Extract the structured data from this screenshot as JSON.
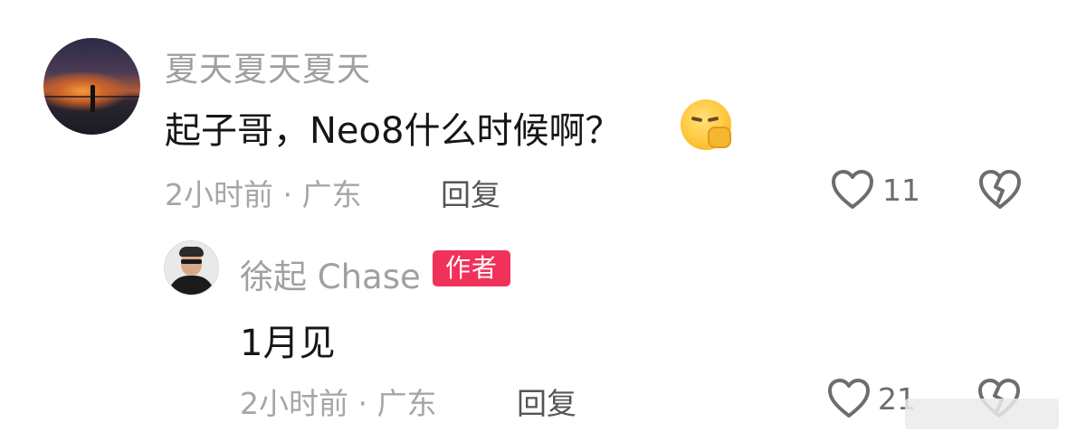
{
  "comments": [
    {
      "username": "夏天夏天夏天",
      "text": "起子哥，Neo8什么时候啊？",
      "emoji_icon": "shushing-face-emoji",
      "meta": "2小时前 · 广东",
      "reply_label": "回复",
      "like_count": "11"
    },
    {
      "username": "徐起 Chase",
      "badge": "作者",
      "text": "1月见",
      "meta": "2小时前 · 广东",
      "reply_label": "回复",
      "like_count": "21"
    }
  ],
  "colors": {
    "badge": "#f0325a",
    "muted_text": "#a0a0a0",
    "primary_text": "#161616"
  }
}
